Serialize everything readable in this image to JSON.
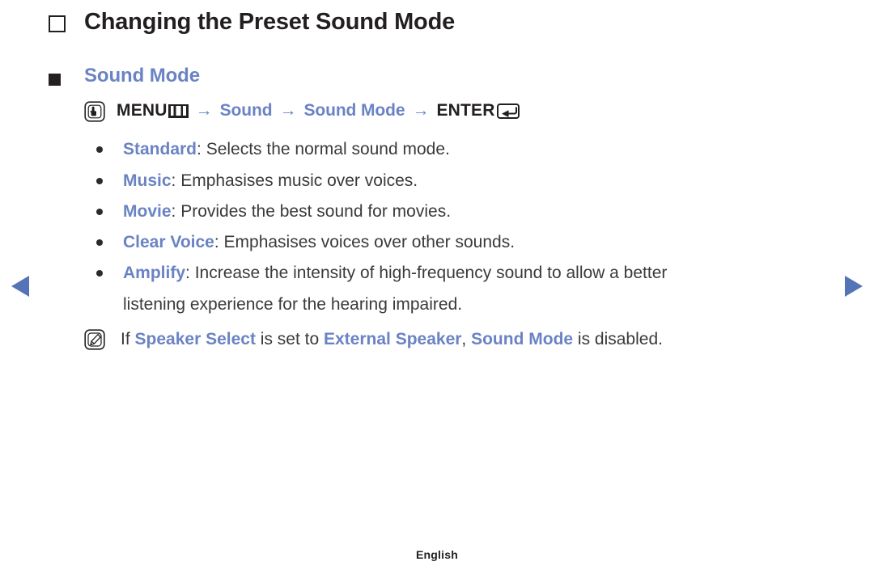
{
  "colors": {
    "accent_blue": "#6a83c3",
    "body_text": "#3a3a3a",
    "heading_text": "#231f20",
    "background": "#ffffff"
  },
  "nav": {
    "prev_label": "◀",
    "prev_icon": "triangle-left-icon",
    "next_label": "▶",
    "next_icon": "triangle-right-icon"
  },
  "title": {
    "bullet_icon": "hollow-square-bullet-icon",
    "text": "Changing the Preset Sound Mode"
  },
  "subheading": {
    "bullet_icon": "solid-square-bullet-icon",
    "text": "Sound Mode"
  },
  "menu_path": {
    "press_icon": "hand-press-oo-icon",
    "press_icon_label": "OO",
    "menu_label": "MENU",
    "menu_glyph_icon": "menu-bars-glyph-icon",
    "arrow": "→",
    "step1": "Sound",
    "step2": "Sound Mode",
    "enter_label": "ENTER",
    "enter_glyph_icon": "enter-return-glyph-icon",
    "full_text": "OO MENU▥ → Sound → Sound Mode → ENTER↵"
  },
  "options": [
    {
      "bullet_icon": "round-dot-bullet-icon",
      "term": "Standard",
      "separator": ": ",
      "description": "Selects the normal sound mode.",
      "continuation": ""
    },
    {
      "bullet_icon": "round-dot-bullet-icon",
      "term": "Music",
      "separator": ": ",
      "description": "Emphasises music over voices.",
      "continuation": ""
    },
    {
      "bullet_icon": "round-dot-bullet-icon",
      "term": "Movie",
      "separator": ": ",
      "description": "Provides the best sound for movies.",
      "continuation": ""
    },
    {
      "bullet_icon": "round-dot-bullet-icon",
      "term": "Clear Voice",
      "separator": ": ",
      "description": "Emphasises voices over other sounds.",
      "continuation": ""
    },
    {
      "bullet_icon": "round-dot-bullet-icon",
      "term": "Amplify",
      "separator": ": ",
      "description": "Increase the intensity of high-frequency sound to allow a better",
      "continuation": "listening experience for the hearing impaired."
    }
  ],
  "note": {
    "icon": "note-pencil-nn-icon",
    "icon_label": "NN",
    "part1": "If ",
    "term1": "Speaker Select",
    "part2": " is set to ",
    "term2": "External Speaker",
    "part3": ", ",
    "term3": "Sound Mode",
    "part4": " is disabled.",
    "full_text": "If Speaker Select is set to External Speaker, Sound Mode is disabled."
  },
  "footer": {
    "language": "English"
  }
}
